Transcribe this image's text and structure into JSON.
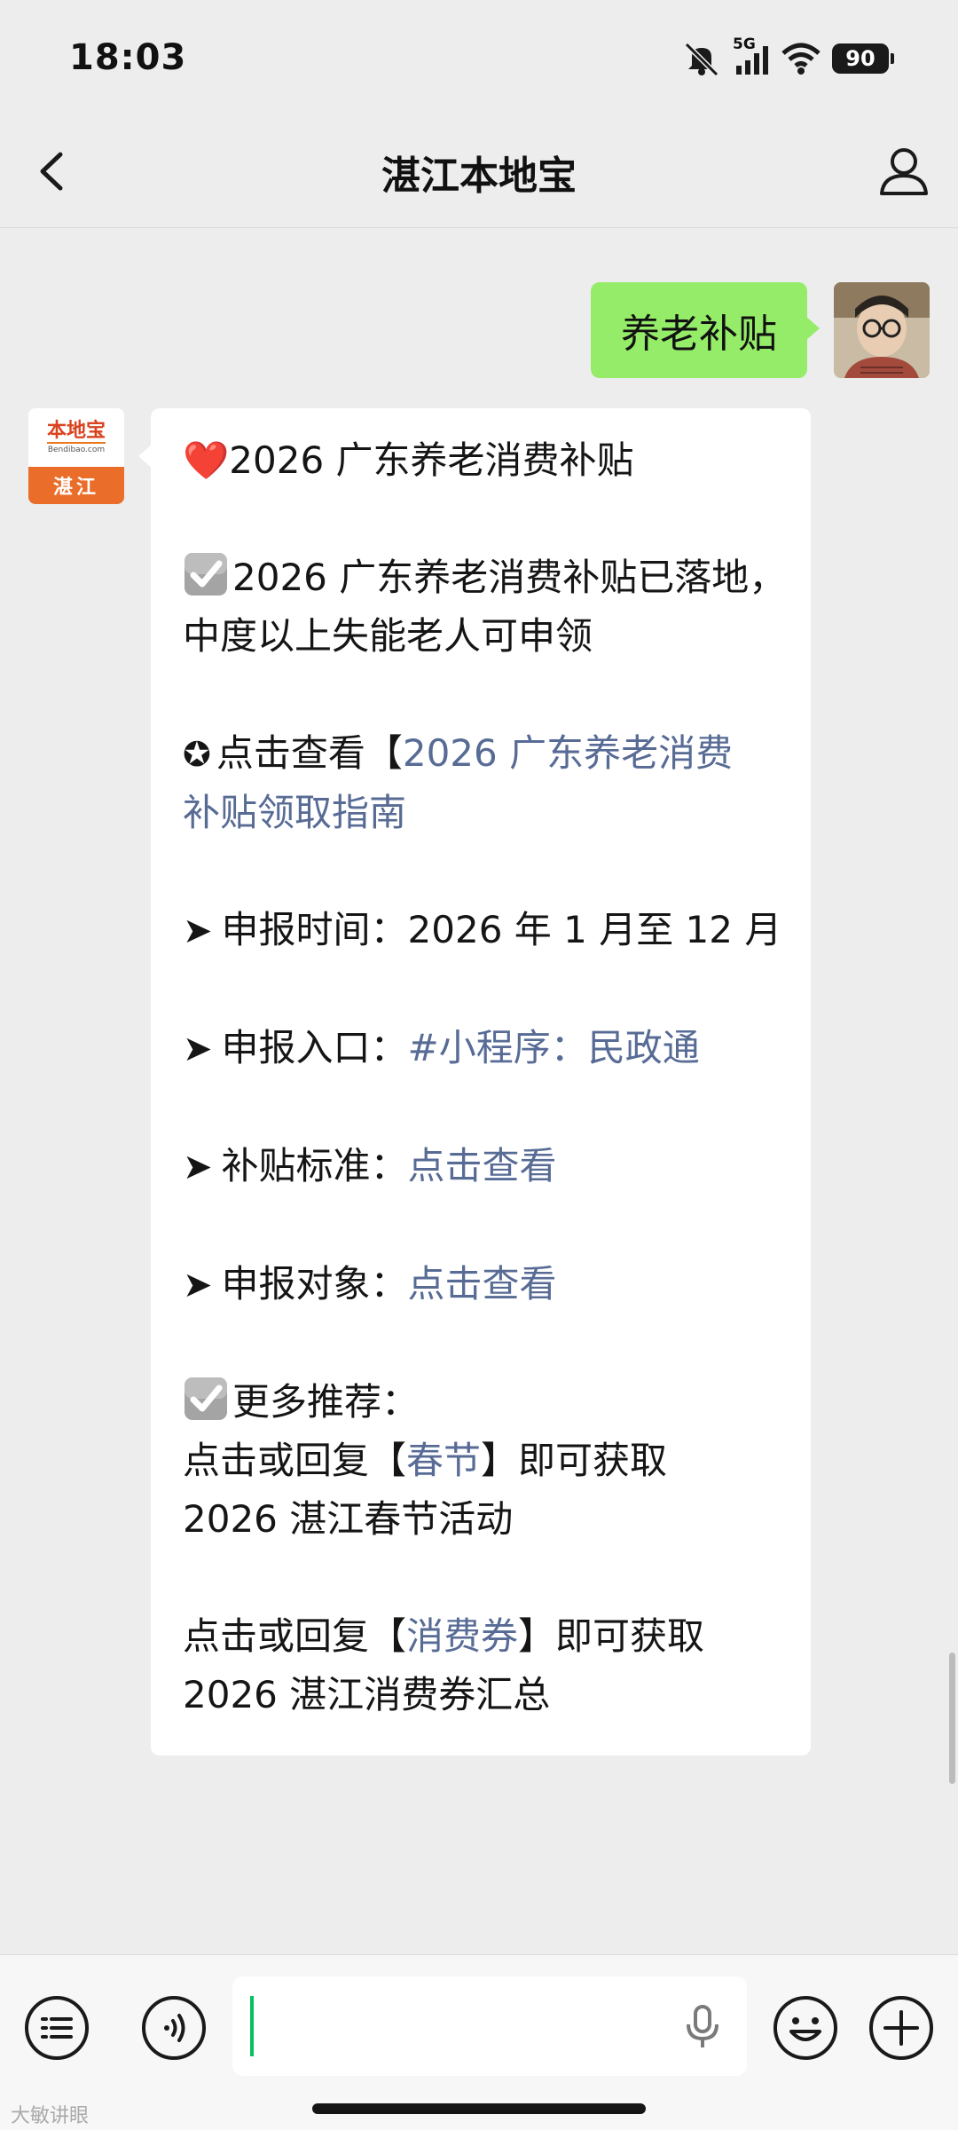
{
  "status_bar": {
    "time": "18:03",
    "network": "5G",
    "battery": "90",
    "icons": [
      "mute-icon",
      "signal-icon",
      "wifi-icon",
      "battery-icon"
    ]
  },
  "nav": {
    "title": "湛江本地宝",
    "back_icon": "chevron-left-icon",
    "profile_icon": "person-icon"
  },
  "outgoing_message": {
    "text": "养老补贴"
  },
  "bot_avatar": {
    "logo_text": "本地宝",
    "logo_sub": "Bendibao.com",
    "city": "湛江"
  },
  "incoming_message": {
    "heart": "❤️",
    "title": "2026 广东养老消费补贴",
    "notice_line1": "2026 广东养老消费补贴已落地，",
    "notice_line2": "中度以上失能老人可申领",
    "guide_prefix": "点击查看【",
    "guide_link_line1": "2026 广东养老消费",
    "guide_link_line2": "补贴领取指南",
    "time_label": "申报时间：",
    "time_value": "2026 年 1 月至 12 月",
    "entry_label": "申报入口：",
    "entry_value": "#小程序：民政通",
    "standard_label": "补贴标准：",
    "standard_value": "点击查看",
    "target_label": "申报对象：",
    "target_value": "点击查看",
    "more_label": "更多推荐：",
    "rec1_prefix": "点击或回复【",
    "rec1_link": "春节",
    "rec1_suffix": "】即可获取",
    "rec1_line2": "2026 湛江春节活动",
    "rec2_prefix": "点击或回复【",
    "rec2_link": "消费券",
    "rec2_suffix": "】即可获取",
    "rec2_line2": "2026 湛江消费券汇总"
  },
  "input_bar": {
    "menu_icon": "list-menu-icon",
    "voice_icon": "voice-toggle-icon",
    "mic_icon": "microphone-icon",
    "emoji_icon": "emoji-icon",
    "plus_icon": "plus-icon"
  },
  "watermark": "大敏讲眼"
}
